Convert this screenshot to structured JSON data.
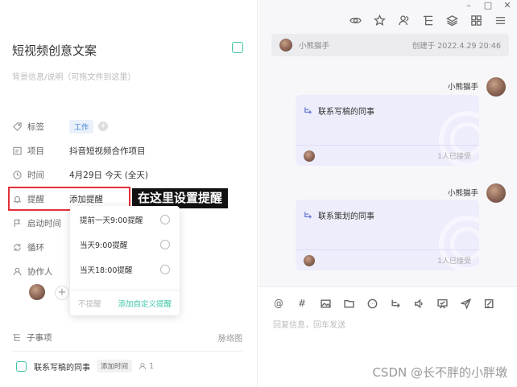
{
  "window": {
    "controls": [
      "–",
      "□",
      "✕"
    ]
  },
  "toolbar": {
    "icons": [
      "eye-icon",
      "star-icon",
      "users-icon",
      "tree-icon",
      "layers-icon",
      "apps-icon",
      "menu-icon"
    ]
  },
  "task": {
    "title": "短视频创意文案",
    "description_placeholder": "背景信息/说明（可拖文件到这里）"
  },
  "fields": {
    "tag_label": "标签",
    "tag_value": "工作",
    "project_label": "项目",
    "project_value": "抖音短视频合作项目",
    "time_label": "时间",
    "time_value": "4月29日 今天 (全天)",
    "reminder_label": "提醒",
    "reminder_value": "添加提醒",
    "start_label": "启动时间",
    "repeat_label": "循环",
    "collab_label": "协作人"
  },
  "callout": "在这里设置提醒",
  "dropdown": {
    "options": [
      "提前一天9:00提醒",
      "当天9:00提醒",
      "当天18:00提醒"
    ],
    "no_remind": "不提醒",
    "custom": "添加自定义提醒"
  },
  "subtasks": {
    "header": "子事项",
    "mindmap": "脉络图",
    "item_title": "联系写稿的同事",
    "item_badge": "添加时间",
    "item_count": "1"
  },
  "activity": {
    "creator_name": "小熊猫手",
    "created": "创建于 2022.4.29 20:46",
    "messages": [
      {
        "sender": "小熊猫手",
        "content": "联系写稿的同事",
        "accepted": "1人已接受"
      },
      {
        "sender": "小熊猫手",
        "content": "联系策划的同事",
        "accepted": "1人已接受"
      }
    ]
  },
  "composer": {
    "tools": [
      "at-icon",
      "hash-icon",
      "image-icon",
      "folder-icon",
      "chat-icon",
      "subtask-icon",
      "voice-icon",
      "card-icon",
      "send-icon",
      "edit-icon"
    ],
    "placeholder": "回复信息，回车发送"
  },
  "watermark": "CSDN @长不胖的小胖墩",
  "colors": {
    "accent": "#3dc6a8",
    "link": "#3b7fd6",
    "highlight": "#e5303a",
    "card_bg": "#eeedfc"
  }
}
